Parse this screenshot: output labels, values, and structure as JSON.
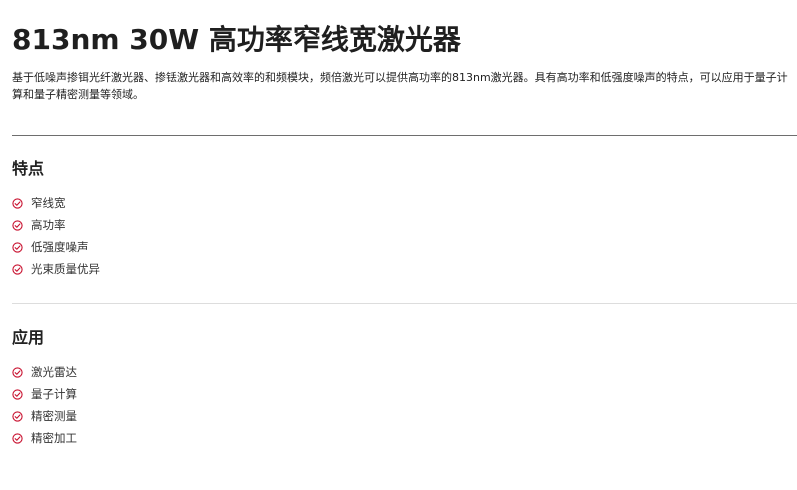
{
  "product": {
    "title": "813nm 30W 高功率窄线宽激光器",
    "description": "基于低噪声掺铒光纤激光器、掺铥激光器和高效率的和频模块，频倍激光可以提供高功率的813nm激光器。具有高功率和低强度噪声的特点，可以应用于量子计算和量子精密测量等领域。"
  },
  "features": {
    "heading": "特点",
    "items": [
      "窄线宽",
      "高功率",
      "低强度噪声",
      "光束质量优异"
    ]
  },
  "applications": {
    "heading": "应用",
    "items": [
      "激光雷达",
      "量子计算",
      "精密测量",
      "精密加工"
    ]
  },
  "colors": {
    "accent": "#c8102e",
    "text": "#222222"
  },
  "icons": {
    "bullet": "check-circle-icon"
  }
}
